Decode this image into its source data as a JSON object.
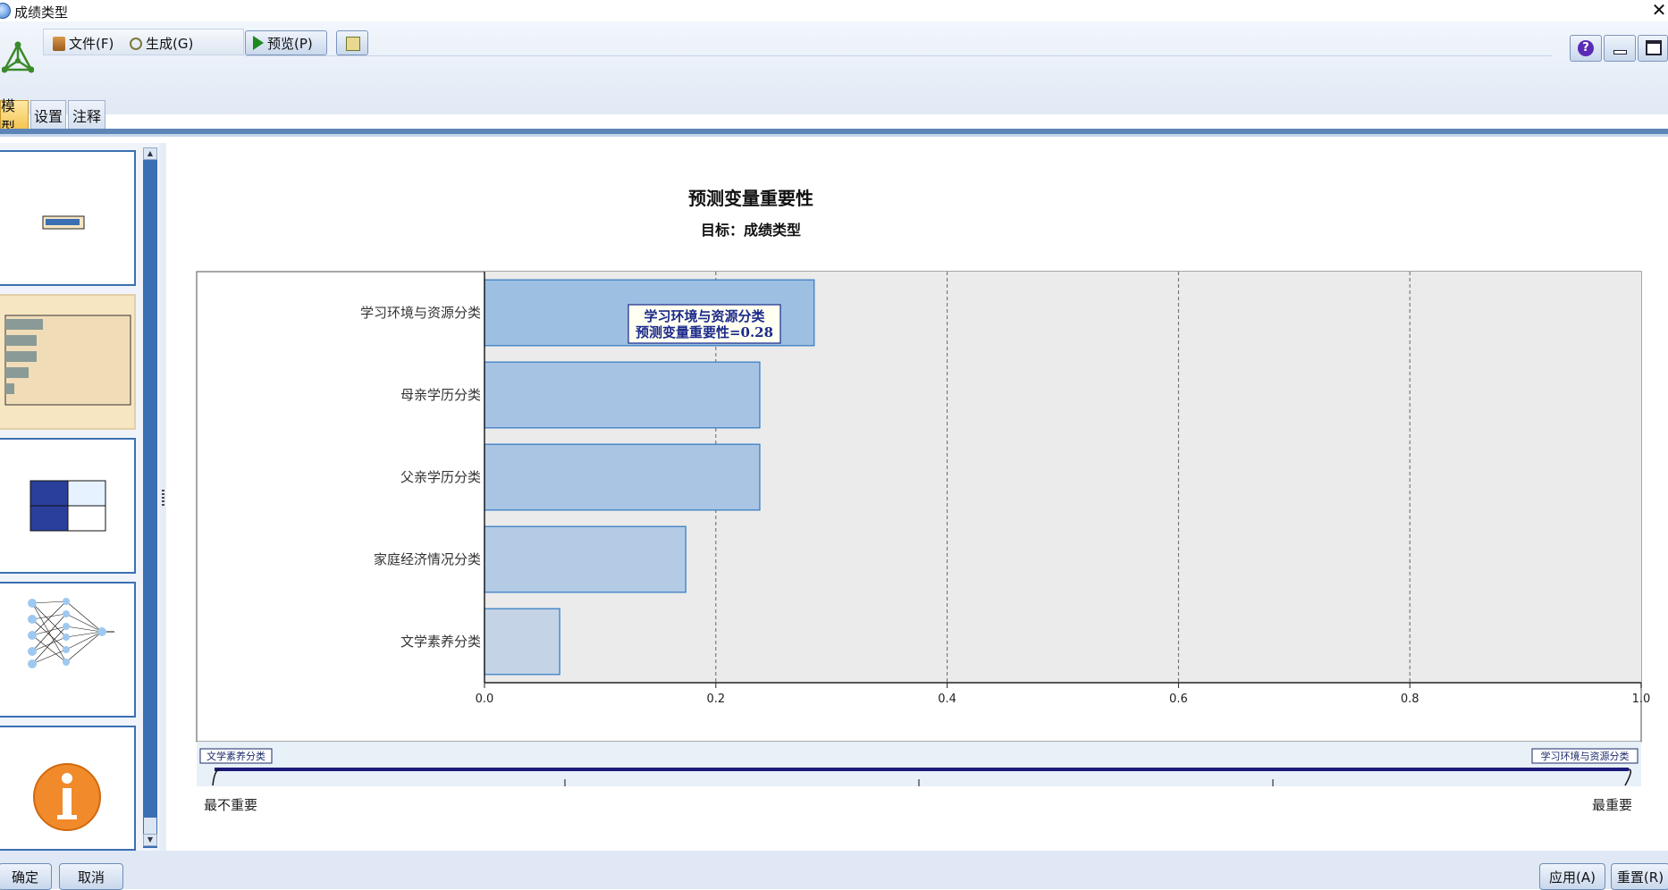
{
  "window": {
    "title": "成绩类型"
  },
  "menu": {
    "file": "文件(F)",
    "generate": "生成(G)"
  },
  "toolbar": {
    "preview": "预览(P)"
  },
  "tabs": [
    "模型",
    "设置",
    "注释"
  ],
  "chart_data": {
    "type": "bar",
    "orientation": "horizontal",
    "title": "预测变量重要性",
    "subtitle": "目标：成绩类型",
    "categories": [
      "学习环境与资源分类",
      "母亲学历分类",
      "父亲学历分类",
      "家庭经济情况分类",
      "文学素养分类"
    ],
    "values": [
      0.285,
      0.238,
      0.238,
      0.174,
      0.065
    ],
    "xlim": [
      0.0,
      1.0
    ],
    "xticks": [
      "0.0",
      "0.2",
      "0.4",
      "0.6",
      "0.8",
      "1.0"
    ],
    "grid": true,
    "tooltip": {
      "line1": "学习环境与资源分类",
      "line2": "预测变量重要性=0.28"
    },
    "legend": {
      "min_field": "文学素养分类",
      "max_field": "学习环境与资源分类",
      "left_label": "最不重要",
      "right_label": "最重要"
    },
    "colors": {
      "bar_fill_top": "#a3c2e3",
      "bar_fill_bottom": "#c4d4e6",
      "bar_edge": "#3b7fc4",
      "plot_bg": "#ebebeb"
    }
  },
  "buttons": {
    "ok": "确定",
    "cancel": "取消",
    "apply": "应用(A)",
    "reset": "重置(R)"
  }
}
